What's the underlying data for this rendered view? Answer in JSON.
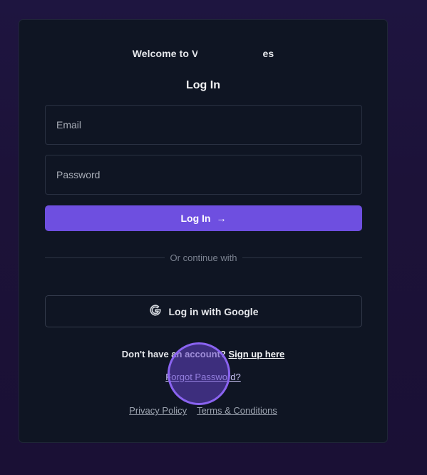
{
  "header": {
    "welcome_prefix": "Welcome to V",
    "welcome_suffix": "es",
    "title": "Log In"
  },
  "form": {
    "email_placeholder": "Email",
    "email_value": "",
    "password_placeholder": "Password",
    "password_value": "",
    "login_label": "Log In",
    "login_arrow": "→"
  },
  "divider": {
    "text": "Or continue with"
  },
  "social": {
    "google_label": "Log in with Google",
    "google_icon": "google-g-icon"
  },
  "signup": {
    "prompt": "Don't have an account?",
    "link": "Sign up here"
  },
  "forgot": {
    "link": "Forgot Password?"
  },
  "footer": {
    "privacy": "Privacy Policy",
    "terms": "Terms & Conditions"
  },
  "colors": {
    "accent": "#6e4fe0",
    "card_bg": "#0f1523",
    "page_bg": "#1c1238"
  }
}
